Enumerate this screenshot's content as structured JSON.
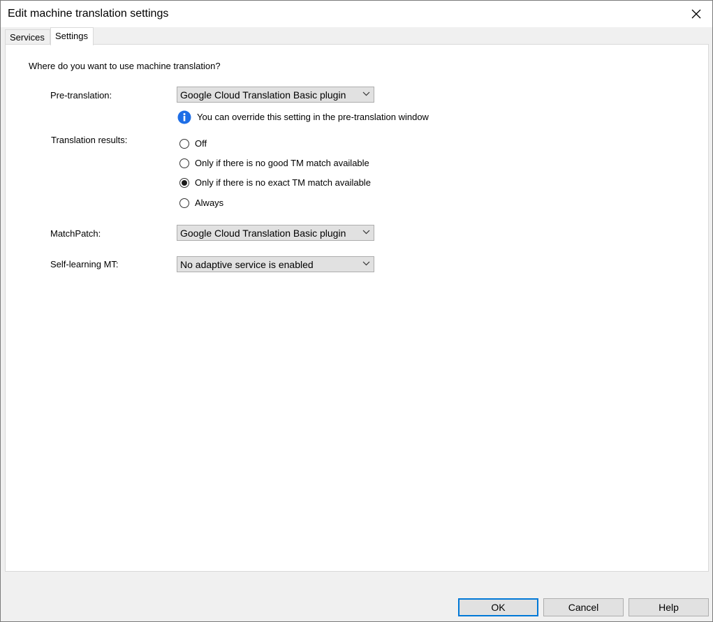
{
  "window": {
    "title": "Edit machine translation settings"
  },
  "tabs": [
    {
      "label": "Services",
      "active": false
    },
    {
      "label": "Settings",
      "active": true
    }
  ],
  "settings": {
    "question": "Where do you want to use machine translation?",
    "pretranslation": {
      "label": "Pre-translation:",
      "value": "Google Cloud Translation Basic plugin",
      "info": "You can override this setting in the pre-translation window"
    },
    "translation_results": {
      "label": "Translation results:",
      "options": [
        {
          "label": "Off",
          "checked": false
        },
        {
          "label": "Only if there is no good TM match available",
          "checked": false
        },
        {
          "label": "Only if there is no exact TM match available",
          "checked": true
        },
        {
          "label": "Always",
          "checked": false
        }
      ]
    },
    "matchpatch": {
      "label": "MatchPatch:",
      "value": "Google Cloud Translation Basic plugin"
    },
    "self_learning": {
      "label": "Self-learning MT:",
      "value": "No adaptive service is enabled"
    }
  },
  "buttons": {
    "ok": "OK",
    "cancel": "Cancel",
    "help": "Help"
  },
  "colors": {
    "accent": "#0078d7",
    "info_icon": "#1e6ee6"
  }
}
